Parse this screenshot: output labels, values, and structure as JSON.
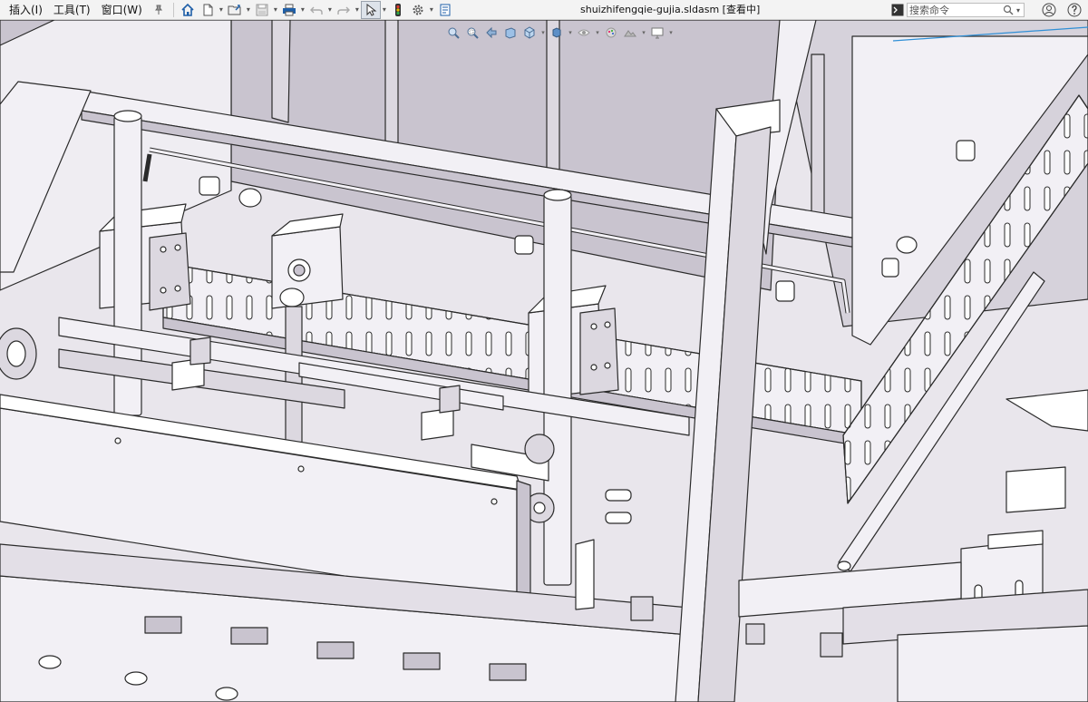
{
  "menu": {
    "items": [
      {
        "label": "插入(I)"
      },
      {
        "label": "工具(T)"
      },
      {
        "label": "窗口(W)"
      }
    ]
  },
  "toolbar": {
    "icons": [
      "home-icon",
      "new-document-icon",
      "open-folder-icon",
      "save-icon",
      "print-icon",
      "undo-icon",
      "redo-icon",
      "select-pointer-icon",
      "rebuild-traffic-light-icon",
      "options-gear-icon",
      "file-properties-icon"
    ]
  },
  "window": {
    "title": "shuizhifengqie-gujia.sldasm [查看中]"
  },
  "search": {
    "placeholder": "搜索命令",
    "value": ""
  },
  "heads_up_toolbar": {
    "icons": [
      "zoom-to-fit-icon",
      "zoom-to-area-icon",
      "previous-view-icon",
      "section-view-icon",
      "view-orientation-icon",
      "display-style-icon",
      "hide-show-items-icon",
      "edit-appearance-icon",
      "apply-scene-icon",
      "view-settings-icon"
    ]
  },
  "colors": {
    "background": "#e9e6ec",
    "model_face": "#f2f0f5",
    "model_shadow": "#c9c4cf",
    "edge": "#2b2b2b",
    "accent_line": "#2f8fd6"
  }
}
